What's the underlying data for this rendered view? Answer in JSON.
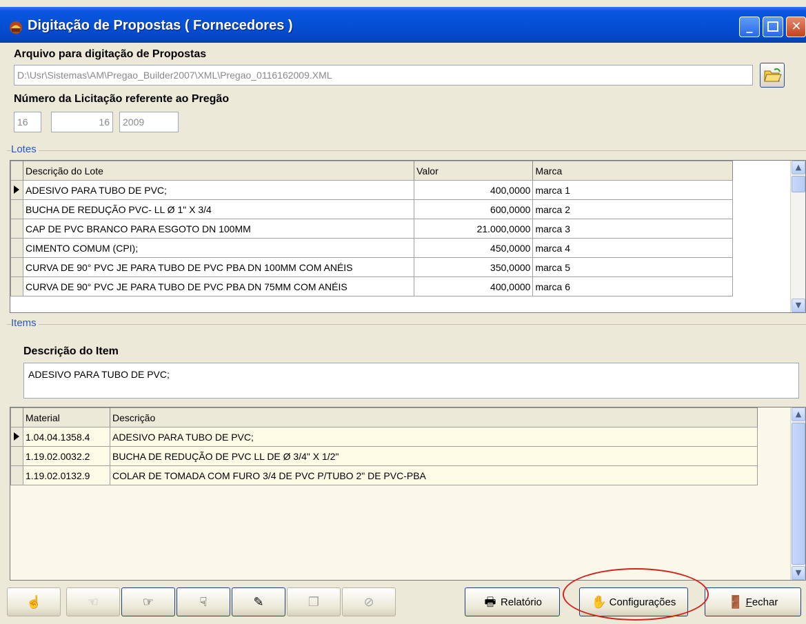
{
  "window": {
    "title": "Digitação de Propostas ( Fornecedores )"
  },
  "arquivo": {
    "label": "Arquivo para digitação de Propostas",
    "path": "D:\\Usr\\Sistemas\\AM\\Pregao_Builder2007\\XML\\Pregao_0116162009.XML"
  },
  "licitacao": {
    "label": "Número da Licitação referente ao Pregão",
    "field1": "16",
    "field2": "16",
    "field3": "2009"
  },
  "lotes": {
    "group_title": "Lotes",
    "columns": [
      "Descrição do Lote",
      "Valor",
      "Marca"
    ],
    "rows": [
      {
        "descricao": "ADESIVO PARA TUBO DE PVC;",
        "valor": "400,0000",
        "marca": "marca 1"
      },
      {
        "descricao": "BUCHA DE REDUÇÃO PVC- LL Ø 1\" X 3/4",
        "valor": "600,0000",
        "marca": "marca 2"
      },
      {
        "descricao": "CAP DE PVC BRANCO PARA ESGOTO DN 100MM",
        "valor": "21.000,0000",
        "marca": "marca 3"
      },
      {
        "descricao": "CIMENTO COMUM (CPI);",
        "valor": "450,0000",
        "marca": "marca 4"
      },
      {
        "descricao": "CURVA DE 90° PVC JE PARA TUBO DE PVC PBA DN 100MM COM ANÉIS",
        "valor": "350,0000",
        "marca": "marca 5"
      },
      {
        "descricao": "CURVA DE 90° PVC JE PARA TUBO DE PVC PBA DN 75MM COM ANÉIS",
        "valor": "400,0000",
        "marca": "marca 6"
      }
    ]
  },
  "items": {
    "group_title": "Items",
    "desc_label": "Descrição do Item",
    "desc_value": "ADESIVO PARA TUBO DE PVC;",
    "columns": [
      "Material",
      "Descrição"
    ],
    "rows": [
      {
        "material": "1.04.04.1358.4",
        "descricao": "ADESIVO PARA TUBO DE PVC;"
      },
      {
        "material": "1.19.02.0032.2",
        "descricao": "BUCHA DE REDUÇÃO DE PVC LL DE Ø 3/4\" X 1/2\""
      },
      {
        "material": "1.19.02.0132.9",
        "descricao": "COLAR DE TOMADA COM FURO 3/4 DE PVC P/TUBO 2\" DE PVC-PBA"
      }
    ]
  },
  "toolbar": {
    "relatorio_label": "Relatório",
    "configuracoes_label": "Configurações",
    "fechar_label": "Fechar",
    "icons": [
      "first-icon",
      "prev-icon",
      "next-icon",
      "last-icon",
      "edit-icon",
      "copy-icon",
      "cancel-icon"
    ]
  },
  "colors": {
    "titlebar": "#0551d6",
    "group_title": "#2a56c6",
    "highlight": "#d2231d"
  }
}
